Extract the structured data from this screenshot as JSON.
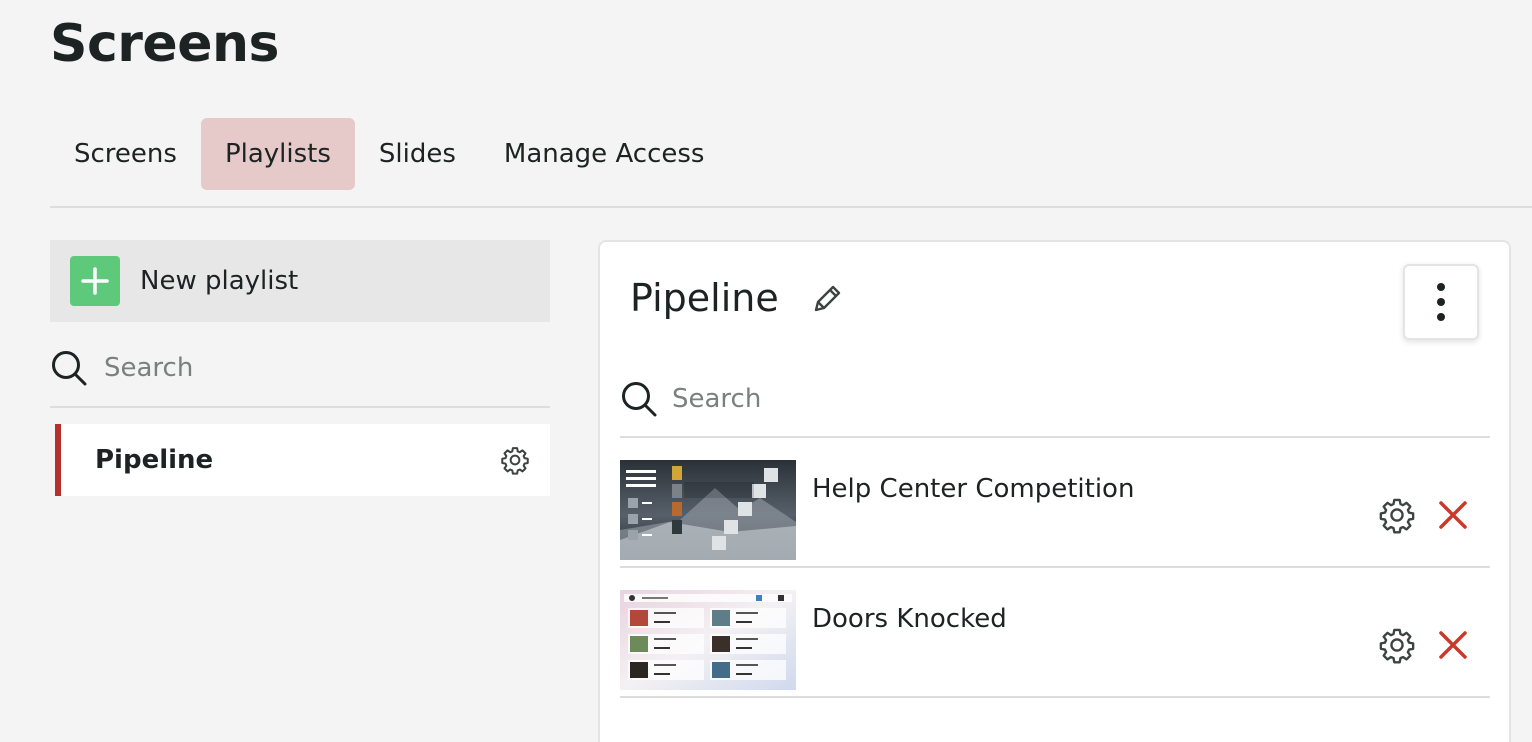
{
  "page": {
    "title": "Screens"
  },
  "tabs": [
    {
      "label": "Screens",
      "active": false
    },
    {
      "label": "Playlists",
      "active": true
    },
    {
      "label": "Slides",
      "active": false
    },
    {
      "label": "Manage Access",
      "active": false
    }
  ],
  "sidebar": {
    "new_playlist_label": "New playlist",
    "search_placeholder": "Search",
    "playlists": [
      {
        "label": "Pipeline",
        "selected": true
      }
    ]
  },
  "panel": {
    "title": "Pipeline",
    "search_placeholder": "Search",
    "slides": [
      {
        "name": "Help Center Competition"
      },
      {
        "name": "Doors Knocked"
      }
    ]
  },
  "colors": {
    "accent_active_tab": "#e6c9c9",
    "selected_indicator": "#b7302b",
    "add_button": "#5ec97a",
    "remove_icon": "#c8392b"
  },
  "icons": {
    "add": "plus-icon",
    "search": "search-icon",
    "settings": "gear-icon",
    "edit": "pencil-icon",
    "more": "kebab-menu-icon",
    "remove": "close-icon"
  }
}
